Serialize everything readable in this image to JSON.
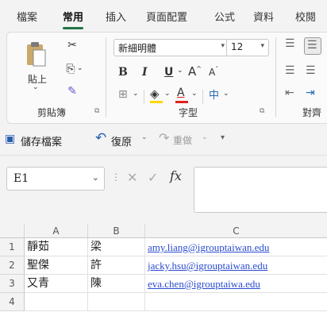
{
  "tabs": [
    "檔案",
    "常用",
    "插入",
    "頁面配置",
    "公式",
    "資料",
    "校閱"
  ],
  "ribbon": {
    "clipboard": {
      "paste_label": "貼上",
      "group_label": "剪貼簿"
    },
    "font": {
      "font_name": "新細明體",
      "font_size": "12",
      "group_label": "字型"
    },
    "align": {
      "group_label": "對齊"
    }
  },
  "qat": {
    "save_label": "儲存檔案",
    "undo_label": "復原",
    "redo_label": "重做"
  },
  "formula_bar": {
    "name_box": "E1",
    "fx_label": "fx",
    "value": ""
  },
  "columns": [
    "A",
    "B",
    "C"
  ],
  "rows": [
    {
      "num": "1",
      "a": "靜茹",
      "b": "梁",
      "c": "amy.liang@igrouptaiwan.edu"
    },
    {
      "num": "2",
      "a": "聖傑",
      "b": "許",
      "c": "jacky.hsu@igrouptaiwan.edu"
    },
    {
      "num": "3",
      "a": "又青",
      "b": "陳",
      "c": "eva.chen@igrouptaiwa.edu"
    },
    {
      "num": "4",
      "a": "",
      "b": "",
      "c": ""
    }
  ],
  "colors": {
    "accent": "#217346",
    "link": "#2a4bd0",
    "font_color": "#e02020",
    "highlight": "#ffd700"
  },
  "icons": [
    "cut-icon",
    "copy-icon",
    "format-painter-icon",
    "bold-icon",
    "italic-icon",
    "underline-icon",
    "grow-font-icon",
    "shrink-font-icon",
    "phonetic-icon",
    "borders-icon",
    "fill-color-icon",
    "font-color-icon",
    "align-icon",
    "save-icon",
    "undo-icon",
    "redo-icon",
    "cancel-icon",
    "enter-icon",
    "fx-icon"
  ]
}
